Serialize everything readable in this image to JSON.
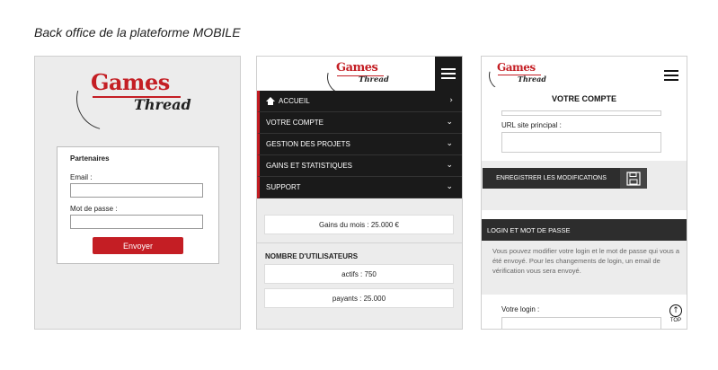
{
  "caption": "Back office de la plateforme MOBILE",
  "logo": {
    "word1": "Games",
    "word2": "Thread"
  },
  "colors": {
    "brand_red": "#c41e24",
    "dark": "#1a1a1a",
    "panel_bg": "#ececec"
  },
  "login": {
    "title": "Partenaires",
    "email_label": "Email :",
    "password_label": "Mot de passe :",
    "submit_label": "Envoyer"
  },
  "menu": {
    "items": [
      {
        "label": "ACCUEIL",
        "icon": "home-icon",
        "chevron": "›"
      },
      {
        "label": "VOTRE COMPTE",
        "chevron": "⌄"
      },
      {
        "label": "GESTION DES PROJETS",
        "chevron": "⌄"
      },
      {
        "label": "GAINS ET STATISTIQUES",
        "chevron": "⌄"
      },
      {
        "label": "SUPPORT",
        "chevron": "⌄"
      }
    ]
  },
  "stats": {
    "gains_mois": "Gains du mois : 25.000 €",
    "users_title": "NOMBRE D'UTILISATEURS",
    "actifs": "actifs : 750",
    "payants": "payants : 25.000"
  },
  "account": {
    "title": "VOTRE COMPTE",
    "url_label": "URL site principal :",
    "save_label": "ENREGISTRER LES MODIFICATIONS",
    "login_section": "LOGIN ET MOT DE PASSE",
    "info": "Vous pouvez modifier votre login et le mot de passe qui vous a été envoyé. Pour les changements de login, un email de vérification vous sera envoyé.",
    "login_label": "Votre login :",
    "top_label": "TOP"
  }
}
